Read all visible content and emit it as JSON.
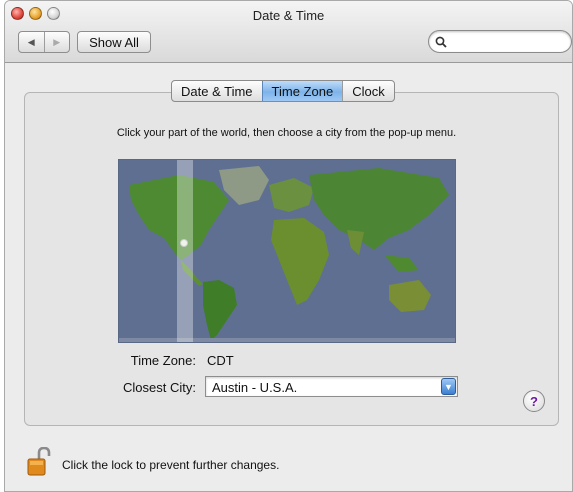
{
  "window": {
    "title": "Date & Time"
  },
  "toolbar": {
    "back_icon": "◀",
    "forward_icon": "▶",
    "show_all_label": "Show All",
    "search_value": "",
    "search_placeholder": ""
  },
  "tabs": [
    {
      "label": "Date & Time",
      "active": false
    },
    {
      "label": "Time Zone",
      "active": true
    },
    {
      "label": "Clock",
      "active": false
    }
  ],
  "instructions": "Click your part of the world, then choose a city from the pop-up menu.",
  "time_zone": {
    "label": "Time Zone:",
    "value": "CDT"
  },
  "closest_city": {
    "label": "Closest City:",
    "value": "Austin - U.S.A."
  },
  "help": {
    "label": "?"
  },
  "lock": {
    "text": "Click the lock to prevent further changes."
  },
  "colors": {
    "ocean": "#5f6f91",
    "land": "#3f8a2a",
    "active_tab": "#7db3ea"
  },
  "icons": [
    "close-icon",
    "minimize-icon",
    "zoom-icon",
    "back-arrow-icon",
    "forward-arrow-icon",
    "search-icon",
    "popup-arrow-icon",
    "help-icon",
    "lock-icon"
  ]
}
